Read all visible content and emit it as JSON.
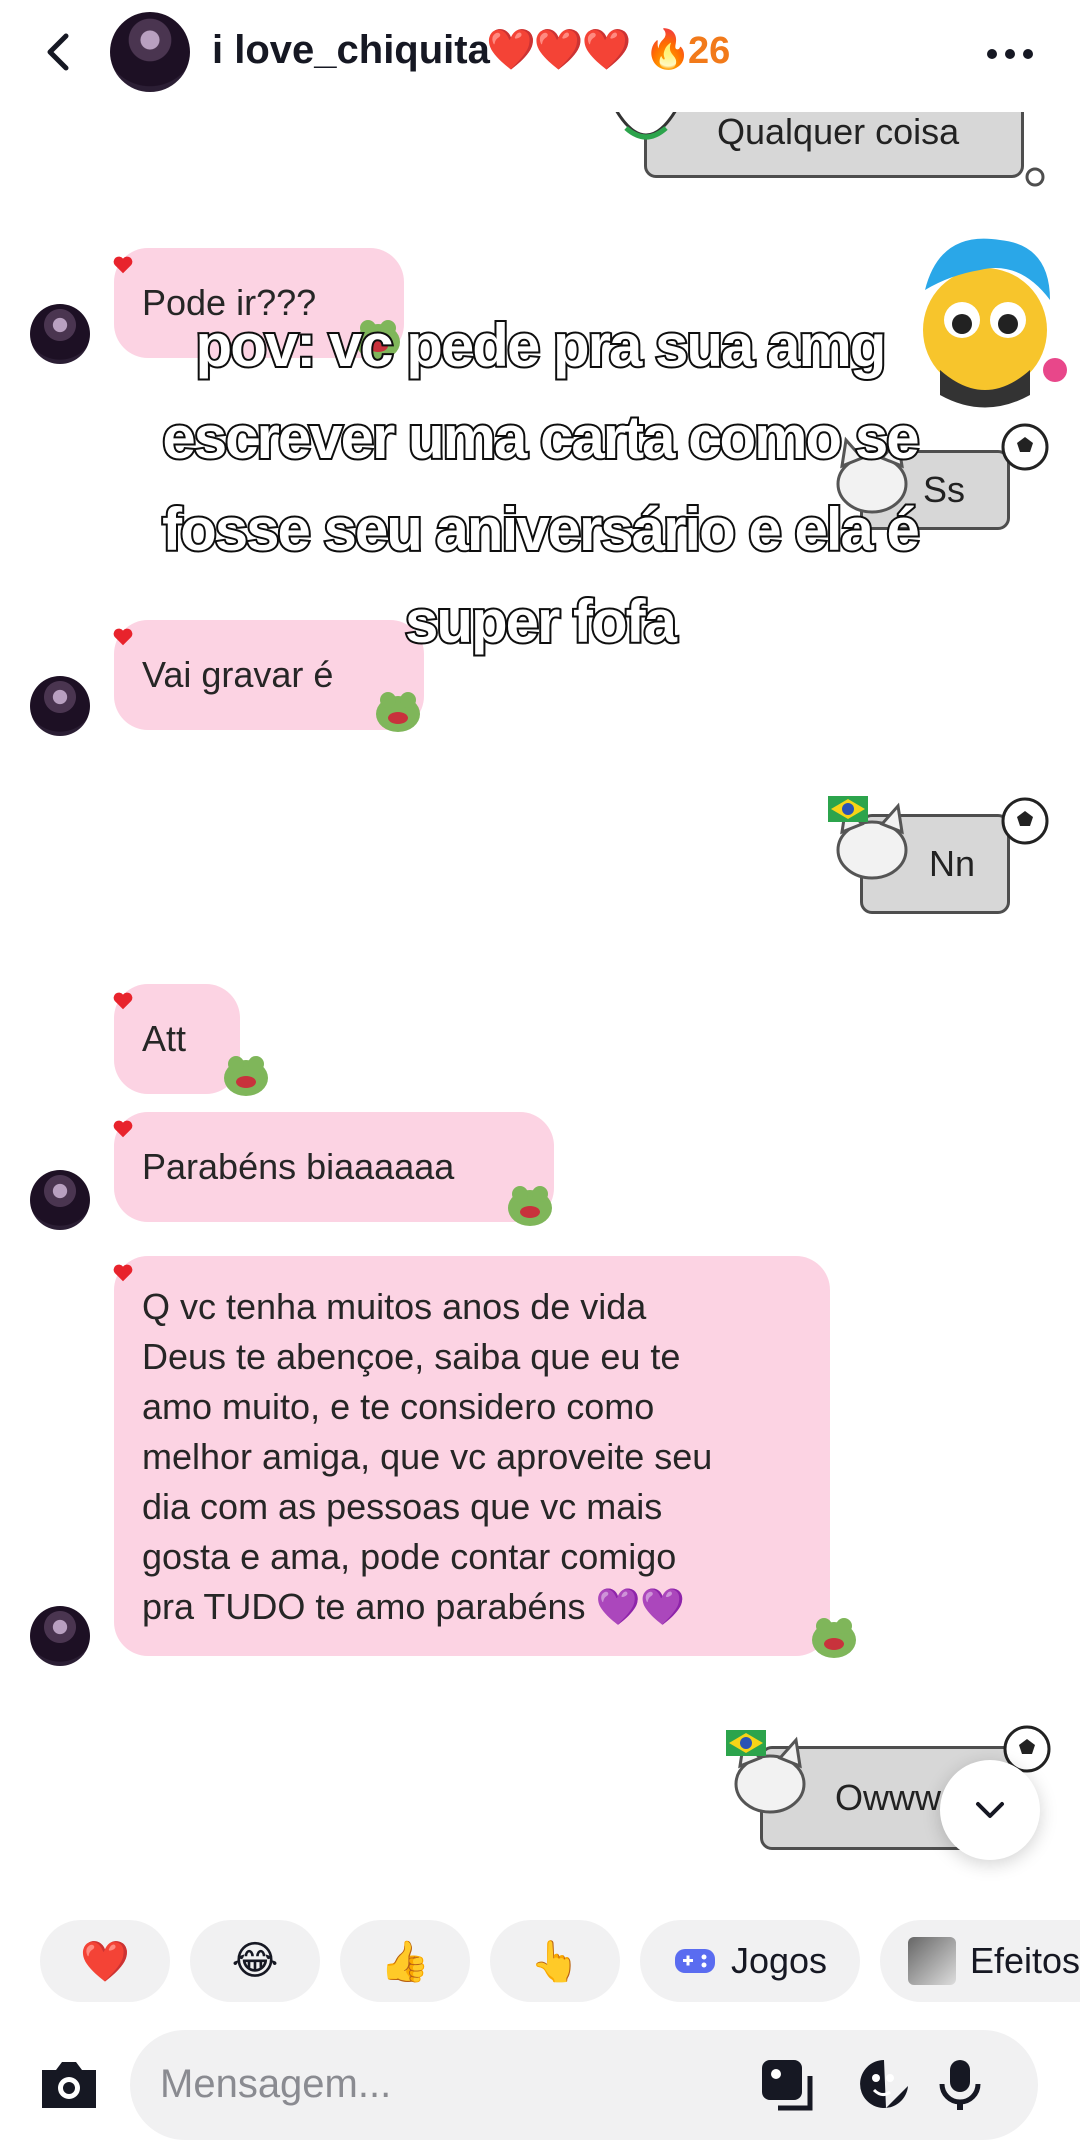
{
  "header": {
    "username": "i love_chiquita",
    "hearts": "❤️❤️❤️",
    "streak_icon": "fire-icon",
    "streak_count": "26"
  },
  "messages": {
    "qualquer": "Qualquer coisa",
    "pode_ir": "Pode ir???",
    "ss": "Ss",
    "vai_gravar": "Vai gravar é",
    "nn": "Nn",
    "att": "Att",
    "parabens": "Parabéns biaaaaaa",
    "long": [
      "Q vc tenha muitos anos de vida",
      "Deus te abençoe, saiba que eu te",
      "amo muito, e te considero como",
      "melhor amiga, que vc aproveite seu",
      "dia com as pessoas que vc mais",
      "gosta e ama, pode contar comigo",
      "pra TUDO te amo parabéns 💜💜"
    ],
    "owww": "Owww"
  },
  "overlay": {
    "lines": [
      "pov: vc pede pra sua amg",
      "escrever uma carta como se",
      "fosse seu aniversário e ela é",
      "super fofa"
    ]
  },
  "quick_reactions": {
    "heart": "❤️",
    "laugh": "😂",
    "thumbs": "👍",
    "point": "👆",
    "games_label": "Jogos",
    "effects_label": "Efeitos"
  },
  "composer": {
    "placeholder": "Mensagem..."
  },
  "colors": {
    "bubble": "#fcd3e3",
    "streak": "#f27a1a",
    "tag": "#d7d7d7"
  }
}
